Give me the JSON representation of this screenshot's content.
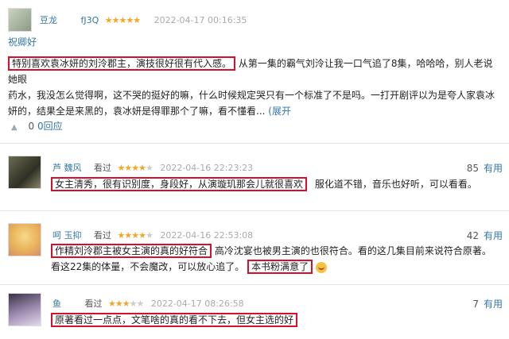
{
  "review1": {
    "user": "豆龙",
    "user2": "fJ3Q",
    "stars": "★★★★★",
    "time": "2022-04-17 00:16:35",
    "subtitle": "祝卿好",
    "highlight": "特别喜欢袁冰妍的刘泠郡主，演技很好很有代入感。",
    "line1_rest": "从第一集的霸气刘泠让我一口气追了8集，哈哈哈，别人老说她眼",
    "line2": "药水，我没怎么觉得啊，这不哭的挺好的嘛，什么时候规定哭只有一个标准了不是吗。一打开剧评以为是夸人家袁冰",
    "line3": "妍的，结果全是来黑的，袁冰妍是得罪那个了嘛，看不懂看...",
    "expand": "(展开",
    "like_count": "0",
    "reply": "0回应"
  },
  "review2": {
    "user": "芦 魏风",
    "watched": "看过",
    "stars_on": "★★★★",
    "stars_off": "★",
    "time": "2022-04-16 22:23:23",
    "useful_count": "85",
    "useful_label": "有用",
    "highlight": "女主清秀，很有识别度，身段好，从演璇玑那会儿就很喜欢",
    "rest": "服化道不错，音乐也好听，可以看看。"
  },
  "review3": {
    "user": "呵 玉抑",
    "watched": "看过",
    "stars_on": "★★★★",
    "stars_off": "★",
    "time": "2022-04-16 22:53:08",
    "useful_count": "42",
    "useful_label": "有用",
    "highlight1": "作精刘泠郡主被女主演的真的好符合",
    "rest1": "高冷沈宴也被男主演的也很符合。看的这几集目前来说符合原著。",
    "line2_pre": "看这22集的体量，不会魔改，可以放心追了。",
    "highlight2": "本书粉满意了",
    "emoji_icon": "grin-emoji"
  },
  "review4": {
    "user": "鱼",
    "watched": "看过",
    "stars_on": "★★★",
    "stars_off": "★★",
    "time": "2022-04-17 08:26:58",
    "useful_count": "7",
    "useful_label": "有用",
    "highlight": "原著看过一点点，文笔啥的真的看不下去，但女主选的好"
  }
}
